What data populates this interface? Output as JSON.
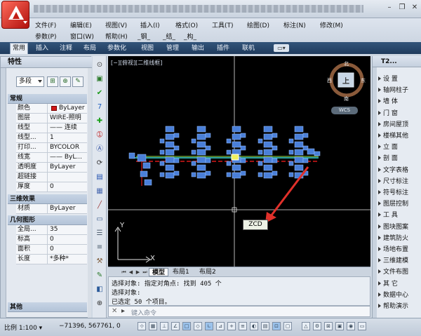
{
  "menu": [
    {
      "label": "文件(F)"
    },
    {
      "label": "编辑(E)"
    },
    {
      "label": "视图(V)"
    },
    {
      "label": "插入(I)"
    },
    {
      "label": "格式(O)"
    },
    {
      "label": "工具(T)"
    },
    {
      "label": "绘图(D)"
    },
    {
      "label": "标注(N)"
    },
    {
      "label": "修改(M)"
    },
    {
      "label": "参数(P)"
    },
    {
      "label": "窗口(W)"
    },
    {
      "label": "帮助(H)"
    },
    {
      "label": "_钢_"
    },
    {
      "label": "_结_"
    },
    {
      "label": "_构_"
    }
  ],
  "window_controls": {
    "minimize": "–",
    "restore": "❐",
    "close": "✕"
  },
  "ribbon_tabs": [
    "常用",
    "插入",
    "注释",
    "布局",
    "参数化",
    "视图",
    "管理",
    "输出",
    "插件",
    "联机"
  ],
  "ribbon_active_tab": "常用",
  "properties": {
    "title": "特性",
    "selector": "多段",
    "sections": {
      "general": "常规",
      "3d": "三维效果",
      "geometry": "几何图形",
      "misc": "其他"
    },
    "general_rows": [
      {
        "label": "颜色",
        "value": "ByLayer",
        "color": "#d01818"
      },
      {
        "label": "图层",
        "value": "WIRE-照明"
      },
      {
        "label": "线型",
        "value": "—— 连续"
      },
      {
        "label": "线型...",
        "value": "1"
      },
      {
        "label": "打印...",
        "value": "BYCOLOR"
      },
      {
        "label": "线宽",
        "value": "—— ByL..."
      },
      {
        "label": "透明度",
        "value": "ByLayer"
      },
      {
        "label": "超链接",
        "value": ""
      },
      {
        "label": "厚度",
        "value": "0"
      }
    ],
    "3d_rows": [
      {
        "label": "材质",
        "value": "ByLayer"
      }
    ],
    "geometry_rows": [
      {
        "label": "全局...",
        "value": "35"
      },
      {
        "label": "标高",
        "value": "0"
      },
      {
        "label": "面积",
        "value": "0"
      },
      {
        "label": "长度",
        "value": "*多种*"
      }
    ]
  },
  "canvas": {
    "view_label": "[−][俯视][二维线框]",
    "compass": {
      "north": "北",
      "south": "南",
      "east": "东",
      "west": "西",
      "top": "上"
    },
    "wcs": "WCS",
    "ucs_x": "X",
    "ucs_y": "Y",
    "tooltip": "ZCD"
  },
  "layout_tabs": [
    "模型",
    "布局1",
    "布局2"
  ],
  "layout_active": "模型",
  "command_lines": [
    "选择对象: 指定对角点: 找到 405 个",
    "选择对象:",
    "已选定 50 个项目。"
  ],
  "command_placeholder": "键入命令",
  "tool_palette": {
    "title": "T2...",
    "items": [
      "设  置",
      "轴网柱子",
      "墙  体",
      "门  窗",
      "房间屋顶",
      "楼梯其他",
      "立  面",
      "剖  面",
      "文字表格",
      "尺寸标注",
      "符号标注",
      "图层控制",
      "工  具",
      "图块图案",
      "建筑防火",
      "场地布置",
      "三维建模",
      "文件布图",
      "其  它",
      "数据中心",
      "帮助演示"
    ]
  },
  "status": {
    "scale": "比例 1:100 ▾",
    "coords": "−71396, 567761, 0"
  },
  "colors": {
    "canvas_bg": "#000000",
    "fixture_blue": "#4a7fd8",
    "wire_red": "#d81818",
    "wire_cyan": "#39d6d6",
    "wire_green": "#9de84a",
    "arrow_red": "#e0302a"
  }
}
